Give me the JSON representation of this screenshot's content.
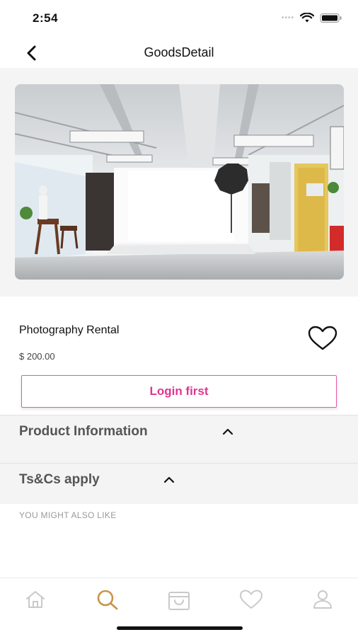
{
  "status_bar": {
    "time": "2:54",
    "icons": [
      "signal-dots-icon",
      "wifi-icon",
      "battery-icon"
    ]
  },
  "nav": {
    "title": "GoodsDetail",
    "back_icon": "chevron-left-icon"
  },
  "product": {
    "image_description_icon": "photo-studio-image",
    "name": "Photography Rental",
    "price": "$ 200.00",
    "favorite_icon": "heart-outline-icon"
  },
  "actions": {
    "login_label": "Login first"
  },
  "sections": [
    {
      "label": "Product Information",
      "icon": "chevron-up-icon"
    },
    {
      "label": "Ts&Cs apply",
      "icon": "chevron-up-icon"
    }
  ],
  "recommendations": {
    "heading": "YOU MIGHT ALSO LIKE"
  },
  "tab_bar": {
    "tabs": [
      {
        "name": "home",
        "icon": "home-icon",
        "active": false
      },
      {
        "name": "search",
        "icon": "search-icon",
        "active": true
      },
      {
        "name": "cart",
        "icon": "shopping-bag-icon",
        "active": false
      },
      {
        "name": "favorites",
        "icon": "heart-icon",
        "active": false
      },
      {
        "name": "profile",
        "icon": "user-icon",
        "active": false
      }
    ]
  },
  "colors": {
    "accent_pink": "#e0358f",
    "active_tab": "#c8944a",
    "inactive_tab": "#c9c9c9",
    "section_bg": "#f4f4f4"
  }
}
